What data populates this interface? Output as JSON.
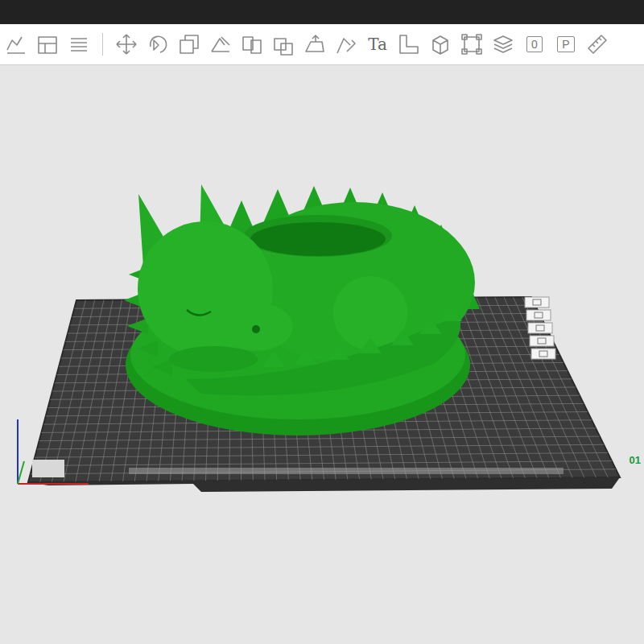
{
  "toolbar": {
    "items": [
      {
        "kind": "icon"
      },
      {
        "kind": "icon"
      },
      {
        "kind": "icon"
      },
      {
        "kind": "separator"
      },
      {
        "kind": "icon"
      },
      {
        "kind": "icon"
      },
      {
        "kind": "icon"
      },
      {
        "kind": "icon"
      },
      {
        "kind": "icon"
      },
      {
        "kind": "icon"
      },
      {
        "kind": "icon"
      },
      {
        "kind": "icon"
      },
      {
        "kind": "text",
        "label": "Ta"
      },
      {
        "kind": "icon"
      },
      {
        "kind": "icon"
      },
      {
        "kind": "icon"
      },
      {
        "kind": "icon"
      },
      {
        "kind": "boxed",
        "label": "0"
      },
      {
        "kind": "boxed",
        "label": "P"
      },
      {
        "kind": "icon"
      }
    ]
  },
  "plate": {
    "label": "01"
  }
}
